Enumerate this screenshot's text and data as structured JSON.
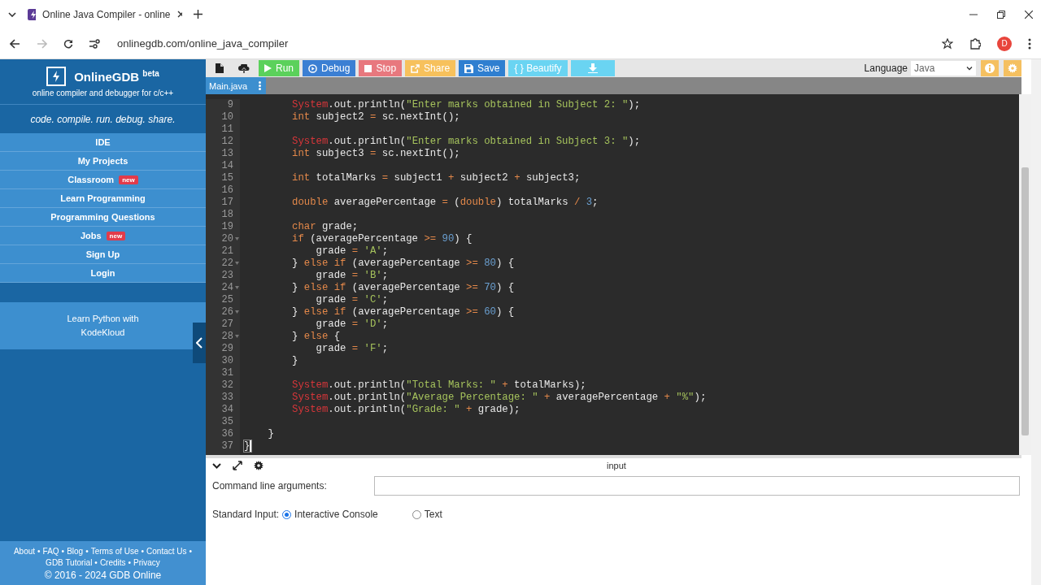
{
  "browser": {
    "tab_title": "Online Java Compiler - online",
    "url": "onlinegdb.com/online_java_compiler",
    "profile_initial": "D"
  },
  "sidebar": {
    "brand": "OnlineGDB",
    "brand_badge": "beta",
    "tagline": "online compiler and debugger for c/c++",
    "motto": "code. compile. run. debug. share.",
    "items": [
      {
        "label": "IDE"
      },
      {
        "label": "My Projects"
      },
      {
        "label": "Classroom",
        "badge": "new"
      },
      {
        "label": "Learn Programming"
      },
      {
        "label": "Programming Questions"
      },
      {
        "label": "Jobs",
        "badge": "new"
      },
      {
        "label": "Sign Up"
      },
      {
        "label": "Login"
      }
    ],
    "promo": "Learn Python with KodeKloud",
    "footer_separator": "•",
    "footer_links": [
      [
        "About",
        "FAQ",
        "Blog",
        "Terms of Use",
        "Contact Us"
      ],
      [
        "GDB Tutorial",
        "Credits",
        "Privacy"
      ]
    ],
    "copyright": "© 2016 - 2024 GDB Online"
  },
  "toolbar": {
    "buttons": [
      {
        "kind": "new-file"
      },
      {
        "kind": "upload"
      },
      {
        "kind": "run",
        "label": "Run"
      },
      {
        "kind": "debug",
        "label": "Debug"
      },
      {
        "kind": "stop",
        "label": "Stop"
      },
      {
        "kind": "share",
        "label": "Share"
      },
      {
        "kind": "save",
        "label": "Save"
      },
      {
        "kind": "beautify",
        "label": "{ } Beautify"
      },
      {
        "kind": "download"
      }
    ],
    "language_label": "Language",
    "language": "Java"
  },
  "file_tab": "Main.java",
  "editor": {
    "lines": [
      {
        "number": "9",
        "tokens": [
          {
            "kind": "sys",
            "text": "        System"
          },
          {
            "kind": "plain",
            "text": ".out.println("
          },
          {
            "kind": "str",
            "text": "\"Enter marks obtained in Subject 2: \""
          },
          {
            "kind": "plain",
            "text": ");"
          }
        ]
      },
      {
        "number": "10",
        "tokens": [
          {
            "kind": "kw",
            "text": "        int"
          },
          {
            "kind": "plain",
            "text": " subject2 "
          },
          {
            "kind": "op",
            "text": "="
          },
          {
            "kind": "plain",
            "text": " sc.nextInt();"
          }
        ]
      },
      {
        "number": "11"
      },
      {
        "number": "12",
        "tokens": [
          {
            "kind": "sys",
            "text": "        System"
          },
          {
            "kind": "plain",
            "text": ".out.println("
          },
          {
            "kind": "str",
            "text": "\"Enter marks obtained in Subject 3: \""
          },
          {
            "kind": "plain",
            "text": ");"
          }
        ]
      },
      {
        "number": "13",
        "tokens": [
          {
            "kind": "kw",
            "text": "        int"
          },
          {
            "kind": "plain",
            "text": " subject3 "
          },
          {
            "kind": "op",
            "text": "="
          },
          {
            "kind": "plain",
            "text": " sc.nextInt();"
          }
        ]
      },
      {
        "number": "14"
      },
      {
        "number": "15",
        "tokens": [
          {
            "kind": "kw",
            "text": "        int"
          },
          {
            "kind": "plain",
            "text": " totalMarks "
          },
          {
            "kind": "op",
            "text": "="
          },
          {
            "kind": "plain",
            "text": " subject1 "
          },
          {
            "kind": "op",
            "text": "+"
          },
          {
            "kind": "plain",
            "text": " subject2 "
          },
          {
            "kind": "op",
            "text": "+"
          },
          {
            "kind": "plain",
            "text": " subject3;"
          }
        ]
      },
      {
        "number": "16"
      },
      {
        "number": "17",
        "tokens": [
          {
            "kind": "kw",
            "text": "        double"
          },
          {
            "kind": "plain",
            "text": " averagePercentage "
          },
          {
            "kind": "op",
            "text": "="
          },
          {
            "kind": "plain",
            "text": " ("
          },
          {
            "kind": "kw",
            "text": "double"
          },
          {
            "kind": "plain",
            "text": ") totalMarks "
          },
          {
            "kind": "op",
            "text": "/ "
          },
          {
            "kind": "num",
            "text": "3"
          },
          {
            "kind": "plain",
            "text": ";"
          }
        ]
      },
      {
        "number": "18"
      },
      {
        "number": "19",
        "tokens": [
          {
            "kind": "kw",
            "text": "        char"
          },
          {
            "kind": "plain",
            "text": " grade;"
          }
        ]
      },
      {
        "number": "20",
        "fold": true,
        "tokens": [
          {
            "kind": "kw",
            "text": "        if"
          },
          {
            "kind": "plain",
            "text": " (averagePercentage "
          },
          {
            "kind": "op",
            "text": ">= "
          },
          {
            "kind": "num",
            "text": "90"
          },
          {
            "kind": "plain",
            "text": ") {"
          }
        ]
      },
      {
        "number": "21",
        "tokens": [
          {
            "kind": "plain",
            "text": "            grade "
          },
          {
            "kind": "op",
            "text": "= "
          },
          {
            "kind": "str",
            "text": "'A'"
          },
          {
            "kind": "plain",
            "text": ";"
          }
        ]
      },
      {
        "number": "22",
        "fold": true,
        "tokens": [
          {
            "kind": "plain",
            "text": "        } "
          },
          {
            "kind": "kw",
            "text": "else if"
          },
          {
            "kind": "plain",
            "text": " (averagePercentage "
          },
          {
            "kind": "op",
            "text": ">= "
          },
          {
            "kind": "num",
            "text": "80"
          },
          {
            "kind": "plain",
            "text": ") {"
          }
        ]
      },
      {
        "number": "23",
        "tokens": [
          {
            "kind": "plain",
            "text": "            grade "
          },
          {
            "kind": "op",
            "text": "= "
          },
          {
            "kind": "str",
            "text": "'B'"
          },
          {
            "kind": "plain",
            "text": ";"
          }
        ]
      },
      {
        "number": "24",
        "fold": true,
        "tokens": [
          {
            "kind": "plain",
            "text": "        } "
          },
          {
            "kind": "kw",
            "text": "else if"
          },
          {
            "kind": "plain",
            "text": " (averagePercentage "
          },
          {
            "kind": "op",
            "text": ">= "
          },
          {
            "kind": "num",
            "text": "70"
          },
          {
            "kind": "plain",
            "text": ") {"
          }
        ]
      },
      {
        "number": "25",
        "tokens": [
          {
            "kind": "plain",
            "text": "            grade "
          },
          {
            "kind": "op",
            "text": "= "
          },
          {
            "kind": "str",
            "text": "'C'"
          },
          {
            "kind": "plain",
            "text": ";"
          }
        ]
      },
      {
        "number": "26",
        "fold": true,
        "tokens": [
          {
            "kind": "plain",
            "text": "        } "
          },
          {
            "kind": "kw",
            "text": "else if"
          },
          {
            "kind": "plain",
            "text": " (averagePercentage "
          },
          {
            "kind": "op",
            "text": ">= "
          },
          {
            "kind": "num",
            "text": "60"
          },
          {
            "kind": "plain",
            "text": ") {"
          }
        ]
      },
      {
        "number": "27",
        "tokens": [
          {
            "kind": "plain",
            "text": "            grade "
          },
          {
            "kind": "op",
            "text": "= "
          },
          {
            "kind": "str",
            "text": "'D'"
          },
          {
            "kind": "plain",
            "text": ";"
          }
        ]
      },
      {
        "number": "28",
        "fold": true,
        "tokens": [
          {
            "kind": "plain",
            "text": "        } "
          },
          {
            "kind": "kw",
            "text": "else"
          },
          {
            "kind": "plain",
            "text": " {"
          }
        ]
      },
      {
        "number": "29",
        "tokens": [
          {
            "kind": "plain",
            "text": "            grade "
          },
          {
            "kind": "op",
            "text": "= "
          },
          {
            "kind": "str",
            "text": "'F'"
          },
          {
            "kind": "plain",
            "text": ";"
          }
        ]
      },
      {
        "number": "30",
        "tokens": [
          {
            "kind": "plain",
            "text": "        }"
          }
        ]
      },
      {
        "number": "31"
      },
      {
        "number": "32",
        "tokens": [
          {
            "kind": "sys",
            "text": "        System"
          },
          {
            "kind": "plain",
            "text": ".out.println("
          },
          {
            "kind": "str",
            "text": "\"Total Marks: \""
          },
          {
            "kind": "op",
            "text": " +"
          },
          {
            "kind": "plain",
            "text": " totalMarks);"
          }
        ]
      },
      {
        "number": "33",
        "tokens": [
          {
            "kind": "sys",
            "text": "        System"
          },
          {
            "kind": "plain",
            "text": ".out.println("
          },
          {
            "kind": "str",
            "text": "\"Average Percentage: \""
          },
          {
            "kind": "op",
            "text": " +"
          },
          {
            "kind": "plain",
            "text": " averagePercentage "
          },
          {
            "kind": "op",
            "text": "+ "
          },
          {
            "kind": "str",
            "text": "\"%\""
          },
          {
            "kind": "plain",
            "text": ");"
          }
        ]
      },
      {
        "number": "34",
        "tokens": [
          {
            "kind": "sys",
            "text": "        System"
          },
          {
            "kind": "plain",
            "text": ".out.println("
          },
          {
            "kind": "str",
            "text": "\"Grade: \""
          },
          {
            "kind": "op",
            "text": " +"
          },
          {
            "kind": "plain",
            "text": " grade);"
          }
        ]
      },
      {
        "number": "35"
      },
      {
        "number": "36",
        "tokens": [
          {
            "kind": "plain",
            "text": "    }"
          }
        ]
      },
      {
        "number": "37",
        "tokens": [
          {
            "kind": "match",
            "text": "}"
          }
        ]
      }
    ]
  },
  "input_panel": {
    "title": "input",
    "args_label": "Command line arguments:",
    "stdin_label": "Standard Input:",
    "stdin_options": [
      {
        "label": "Interactive Console",
        "selected": true
      },
      {
        "label": "Text",
        "selected": false
      }
    ]
  }
}
